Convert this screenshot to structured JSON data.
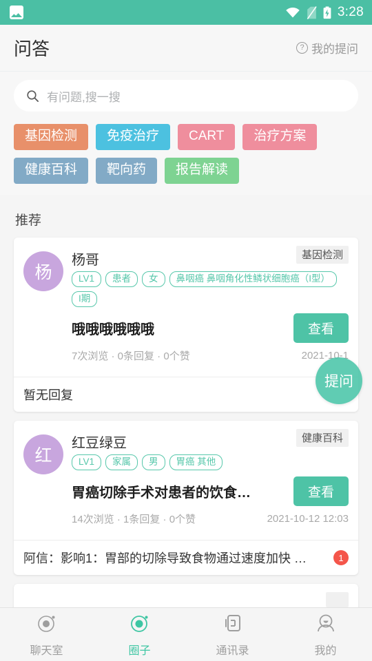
{
  "status_bar": {
    "left_icon": "photo-icon",
    "icons": [
      "wifi-icon",
      "sim-card-off-icon",
      "battery-charging-icon"
    ],
    "time": "3:28",
    "background": "#4bbfa4"
  },
  "header": {
    "title": "问答",
    "action_icon": "question-circle-icon",
    "action_label": "我的提问"
  },
  "search": {
    "icon": "search-icon",
    "placeholder": "有问题,搜一搜",
    "value": ""
  },
  "hot_tags": [
    {
      "label": "基因检测",
      "color": "#e8906a"
    },
    {
      "label": "免疫治疗",
      "color": "#4cc1e0"
    },
    {
      "label": "CART",
      "color": "#ef8e9d"
    },
    {
      "label": "治疗方案",
      "color": "#ef8e9d"
    },
    {
      "label": "健康百科",
      "color": "#82aac6"
    },
    {
      "label": "靶向药",
      "color": "#82aac6"
    },
    {
      "label": "报告解读",
      "color": "#7ed392"
    }
  ],
  "section": {
    "title": "推荐"
  },
  "fab": {
    "label": "提问",
    "color": "#46c4a6"
  },
  "cards": [
    {
      "avatar_text": "杨",
      "avatar_color": "#c8a6de",
      "username": "杨哥",
      "user_tags": [
        "LV1",
        "患者",
        "女",
        "鼻咽癌 鼻咽角化性鳞状细胞癌（I型）",
        "I期"
      ],
      "category": "基因检测",
      "question": "哦哦哦哦哦哦",
      "view_label": "查看",
      "stats": "7次浏览 · 0条回复 · 0个赞",
      "date": "2021-10-1",
      "reply": "暂无回复",
      "reply_count": ""
    },
    {
      "avatar_text": "红",
      "avatar_color": "#c8a6de",
      "username": "红豆绿豆",
      "user_tags": [
        "LV1",
        "家属",
        "男",
        "胃癌 其他"
      ],
      "category": "健康百科",
      "question": "胃癌切除手术对患者的饮食…",
      "view_label": "查看",
      "stats": "14次浏览 · 1条回复 · 0个赞",
      "date": "2021-10-12 12:03",
      "reply": "阿信：影响1：胃部的切除导致食物通过速度加快 …",
      "reply_count": "1"
    }
  ],
  "bottom_nav": [
    {
      "label": "聊天室",
      "icon": "chatroom-orbit-icon",
      "active": false
    },
    {
      "label": "圈子",
      "icon": "circle-orbit-icon",
      "active": true
    },
    {
      "label": "通讯录",
      "icon": "contacts-icon",
      "active": false
    },
    {
      "label": "我的",
      "icon": "person-icon",
      "active": false
    }
  ]
}
